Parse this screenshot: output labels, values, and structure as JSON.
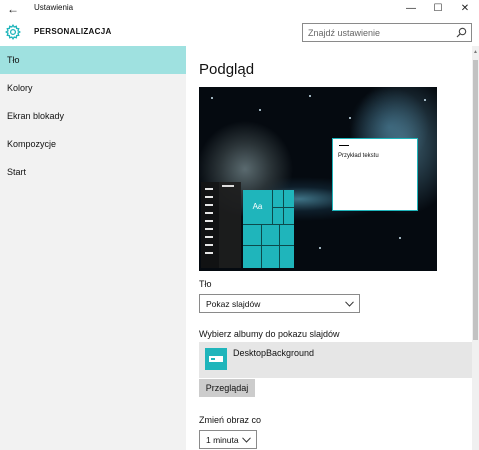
{
  "window": {
    "title": "Ustawienia",
    "back_glyph": "←",
    "minimize_glyph": "—",
    "maximize_glyph": "☐",
    "close_glyph": "✕"
  },
  "header": {
    "section_title": "PERSONALIZACJA",
    "search_placeholder": "Znajdź ustawienie"
  },
  "sidebar": {
    "items": [
      {
        "label": "Tło",
        "active": true
      },
      {
        "label": "Kolory",
        "active": false
      },
      {
        "label": "Ekran blokady",
        "active": false
      },
      {
        "label": "Kompozycje",
        "active": false
      },
      {
        "label": "Start",
        "active": false
      }
    ]
  },
  "main": {
    "preview_heading": "Podgląd",
    "preview": {
      "tile_label": "Aa",
      "sample_text": "Przykład tekstu"
    },
    "background": {
      "label": "Tło",
      "selected": "Pokaz slajdów"
    },
    "albums": {
      "label": "Wybierz albumy do pokazu slajdów",
      "items": [
        "DesktopBackground"
      ],
      "browse_label": "Przeglądaj"
    },
    "interval": {
      "label": "Zmień obraz co",
      "selected": "1 minuta"
    }
  },
  "colors": {
    "accent": "#1fb5bb",
    "active_nav": "#9fe1e0",
    "sidebar_bg": "#f2f2f2"
  }
}
